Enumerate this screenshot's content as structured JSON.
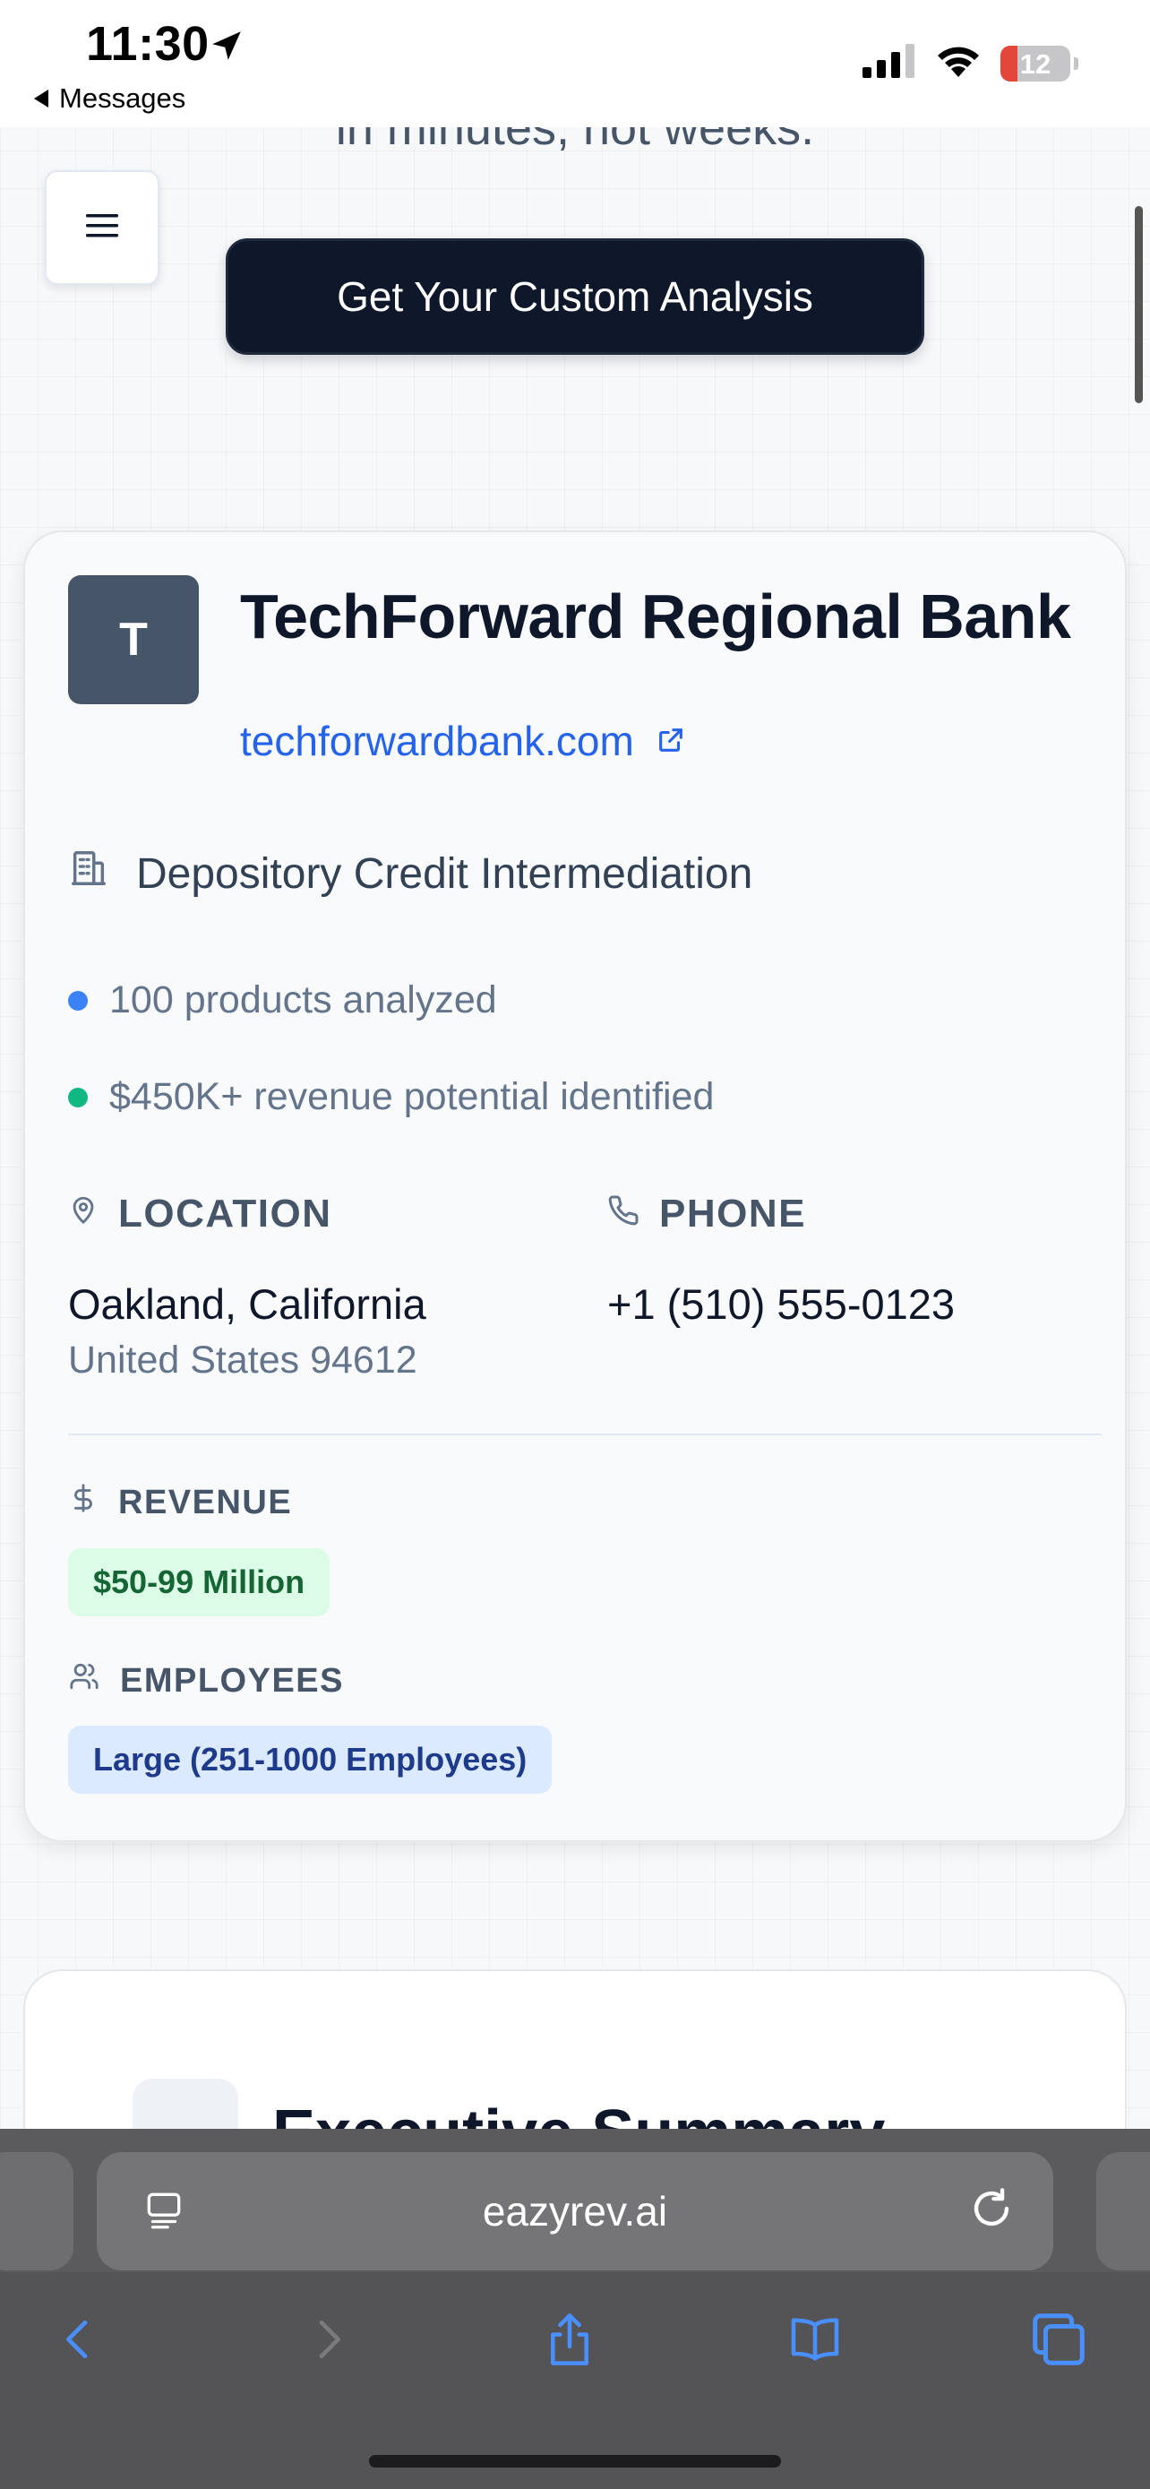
{
  "status_bar": {
    "time": "11:30",
    "back_label": "Messages",
    "battery": "12",
    "icons": [
      "location-arrow-icon",
      "signal-icon",
      "wifi-icon",
      "battery-icon"
    ]
  },
  "hero": {
    "tagline": "in minutes, not weeks.",
    "cta_label": "Get Your Custom Analysis",
    "menu_icon": "hamburger-menu-icon"
  },
  "company": {
    "initial": "T",
    "name": "TechForward Regional Bank",
    "website": "techforwardbank.com",
    "industry": "Depository Credit Intermediation",
    "highlights": [
      {
        "text": "100 products analyzed",
        "color": "#3b82f6"
      },
      {
        "text": "$450K+ revenue potential identified",
        "color": "#10b981"
      }
    ],
    "location": {
      "label": "LOCATION",
      "line1": "Oakland, California",
      "line2": "United States 94612"
    },
    "phone": {
      "label": "PHONE",
      "value": "+1 (510) 555-0123"
    },
    "revenue": {
      "label": "REVENUE",
      "value": "$50-99 Million"
    },
    "employees": {
      "label": "EMPLOYEES",
      "value": "Large (251-1000 Employees)"
    }
  },
  "next_section": {
    "title": "Executive Summary"
  },
  "browser": {
    "url": "eazyrev.ai",
    "toolbar_icons": [
      "back-icon",
      "forward-icon",
      "share-icon",
      "bookmarks-icon",
      "tabs-icon"
    ]
  },
  "colors": {
    "link": "#2563eb",
    "cta_bg": "#0f172a",
    "browser_accent": "#4a8fff"
  }
}
